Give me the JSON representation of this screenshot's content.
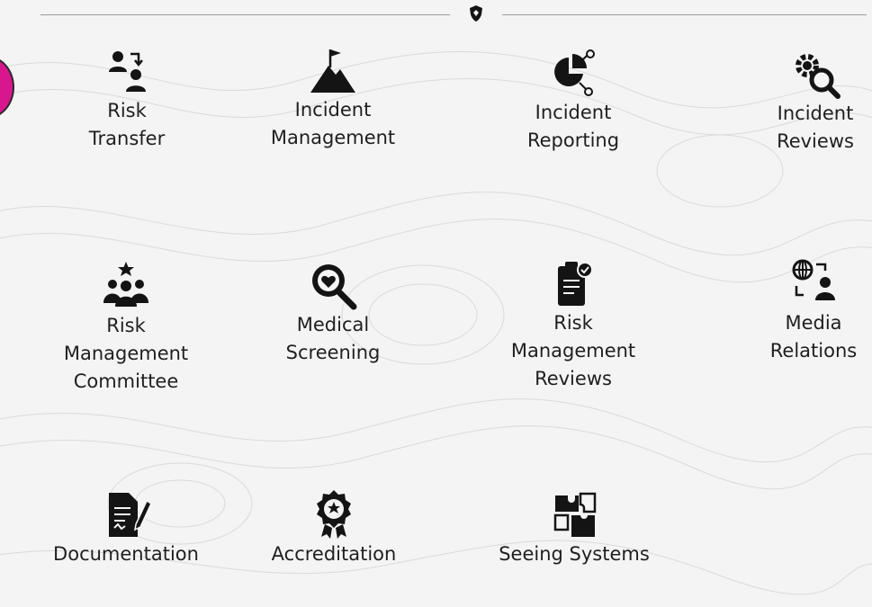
{
  "header": {
    "emblem_icon": "shield-hand-icon"
  },
  "tiles": [
    {
      "label": "Risk\nTransfer",
      "icon": "user-transfer-icon"
    },
    {
      "label": "Incident\nManagement",
      "icon": "mountain-flag-icon"
    },
    {
      "label": "Incident\nReporting",
      "icon": "pie-chart-nodes-icon"
    },
    {
      "label": "Incident\nReviews",
      "icon": "gear-search-icon"
    },
    {
      "label": "Risk\nManagement\nCommittee",
      "icon": "team-star-icon"
    },
    {
      "label": "Medical\nScreening",
      "icon": "heart-magnifier-icon"
    },
    {
      "label": "Risk\nManagement\nReviews",
      "icon": "clipboard-check-icon"
    },
    {
      "label": "Media\nRelations",
      "icon": "globe-user-icon"
    },
    {
      "label": "Documentation",
      "icon": "document-pen-icon"
    },
    {
      "label": "Accreditation",
      "icon": "award-badge-icon"
    },
    {
      "label": "Seeing Systems",
      "icon": "puzzle-pieces-icon"
    }
  ],
  "colors": {
    "background": "#f4f4f4",
    "icon": "#141414",
    "accent_circle": "#d8168e"
  }
}
